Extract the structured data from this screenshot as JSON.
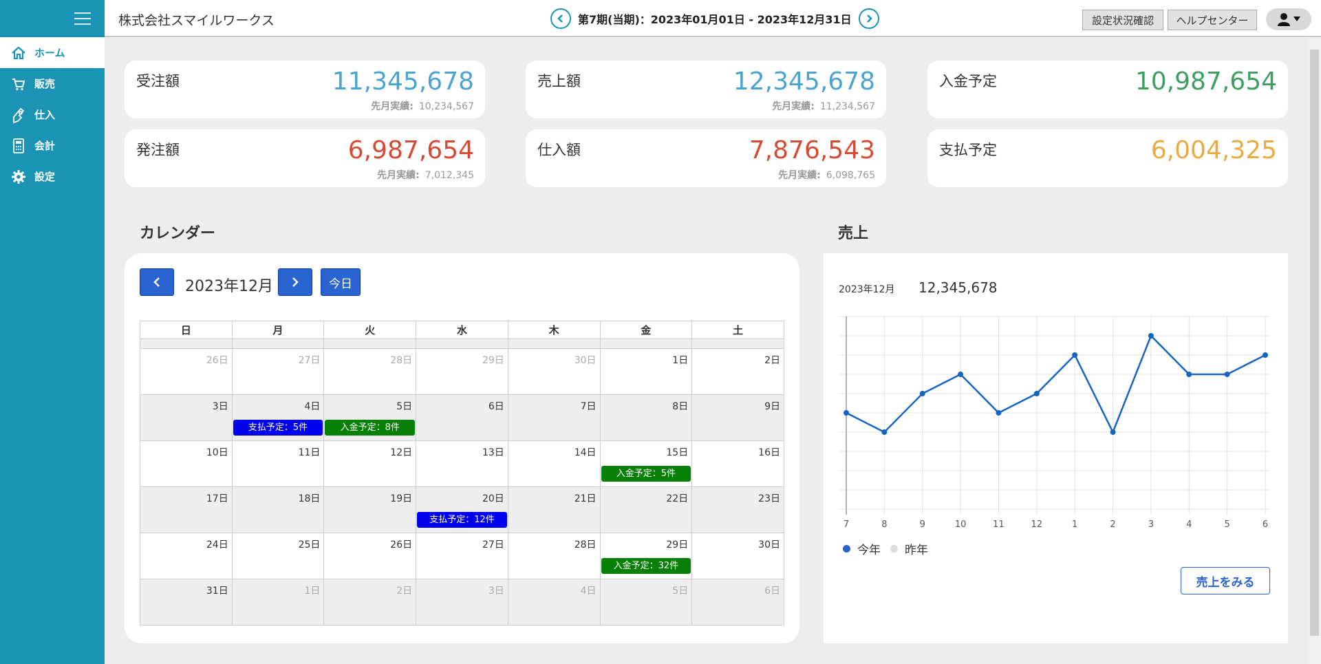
{
  "header": {
    "company": "株式会社スマイルワークス",
    "period": "第7期(当期)：2023年01月01日 - 2023年12月31日",
    "settings_status_label": "設定状況確認",
    "help_center_label": "ヘルプセンター"
  },
  "sidebar": {
    "items": [
      {
        "label": "ホーム",
        "icon": "home-icon"
      },
      {
        "label": "販売",
        "icon": "cart-icon"
      },
      {
        "label": "仕入",
        "icon": "hand-icon"
      },
      {
        "label": "会計",
        "icon": "calculator-icon"
      },
      {
        "label": "設定",
        "icon": "gear-icon"
      }
    ]
  },
  "cards": {
    "orders": {
      "label": "受注額",
      "value": "11,345,678",
      "prev_label": "先月実績:",
      "prev_value": "10,234,567",
      "color": "#4aa3d1"
    },
    "sales": {
      "label": "売上額",
      "value": "12,345,678",
      "prev_label": "先月実績:",
      "prev_value": "11,234,567",
      "color": "#4aa3d1"
    },
    "incoming": {
      "label": "入金予定",
      "value": "10,987,654",
      "color": "#3f9e62"
    },
    "purchase_orders": {
      "label": "発注額",
      "value": "6,987,654",
      "prev_label": "先月実績:",
      "prev_value": "7,012,345",
      "color": "#d64a33"
    },
    "purchases": {
      "label": "仕入額",
      "value": "7,876,543",
      "prev_label": "先月実績:",
      "prev_value": "6,098,765",
      "color": "#d64a33"
    },
    "payments": {
      "label": "支払予定",
      "value": "6,004,325",
      "color": "#e8ac40"
    }
  },
  "calendar": {
    "title": "カレンダー",
    "month": "2023年12月",
    "today_label": "今日",
    "weekdays": [
      "日",
      "月",
      "火",
      "水",
      "木",
      "金",
      "土"
    ],
    "weeks": [
      [
        {
          "d": "26日",
          "m": true
        },
        {
          "d": "27日",
          "m": true
        },
        {
          "d": "28日",
          "m": true
        },
        {
          "d": "29日",
          "m": true
        },
        {
          "d": "30日",
          "m": true
        },
        {
          "d": "1日"
        },
        {
          "d": "2日"
        }
      ],
      [
        {
          "d": "3日"
        },
        {
          "d": "4日",
          "ev": "支払予定：5件",
          "t": "pay"
        },
        {
          "d": "5日",
          "ev": "入金予定：8件",
          "t": "rec"
        },
        {
          "d": "6日"
        },
        {
          "d": "7日"
        },
        {
          "d": "8日"
        },
        {
          "d": "9日"
        }
      ],
      [
        {
          "d": "10日"
        },
        {
          "d": "11日"
        },
        {
          "d": "12日"
        },
        {
          "d": "13日"
        },
        {
          "d": "14日"
        },
        {
          "d": "15日",
          "ev": "入金予定：5件",
          "t": "rec"
        },
        {
          "d": "16日"
        }
      ],
      [
        {
          "d": "17日"
        },
        {
          "d": "18日"
        },
        {
          "d": "19日"
        },
        {
          "d": "20日",
          "ev": "支払予定：12件",
          "t": "pay"
        },
        {
          "d": "21日"
        },
        {
          "d": "22日"
        },
        {
          "d": "23日"
        }
      ],
      [
        {
          "d": "24日"
        },
        {
          "d": "25日"
        },
        {
          "d": "26日"
        },
        {
          "d": "27日"
        },
        {
          "d": "28日"
        },
        {
          "d": "29日",
          "ev": "入金予定：32件",
          "t": "rec"
        },
        {
          "d": "30日"
        }
      ],
      [
        {
          "d": "31日"
        },
        {
          "d": "1日",
          "m": true
        },
        {
          "d": "2日",
          "m": true
        },
        {
          "d": "3日",
          "m": true
        },
        {
          "d": "4日",
          "m": true
        },
        {
          "d": "5日",
          "m": true
        },
        {
          "d": "6日",
          "m": true
        }
      ]
    ]
  },
  "sales_panel": {
    "title": "売上",
    "month": "2023年12月",
    "value": "12,345,678",
    "see_button": "売上をみる"
  },
  "chart_data": {
    "type": "line",
    "categories": [
      "7",
      "8",
      "9",
      "10",
      "11",
      "12",
      "1",
      "2",
      "3",
      "4",
      "5",
      "6"
    ],
    "series": [
      {
        "name": "今年",
        "values": [
          5,
          4,
          6,
          7,
          5,
          6,
          8,
          4,
          9,
          7,
          7,
          8
        ],
        "color": "#1565c0"
      },
      {
        "name": "昨年",
        "values": [],
        "color": "#dddddd"
      }
    ],
    "ylim": [
      0,
      10
    ],
    "grid": true,
    "legend": "bottom-left"
  }
}
